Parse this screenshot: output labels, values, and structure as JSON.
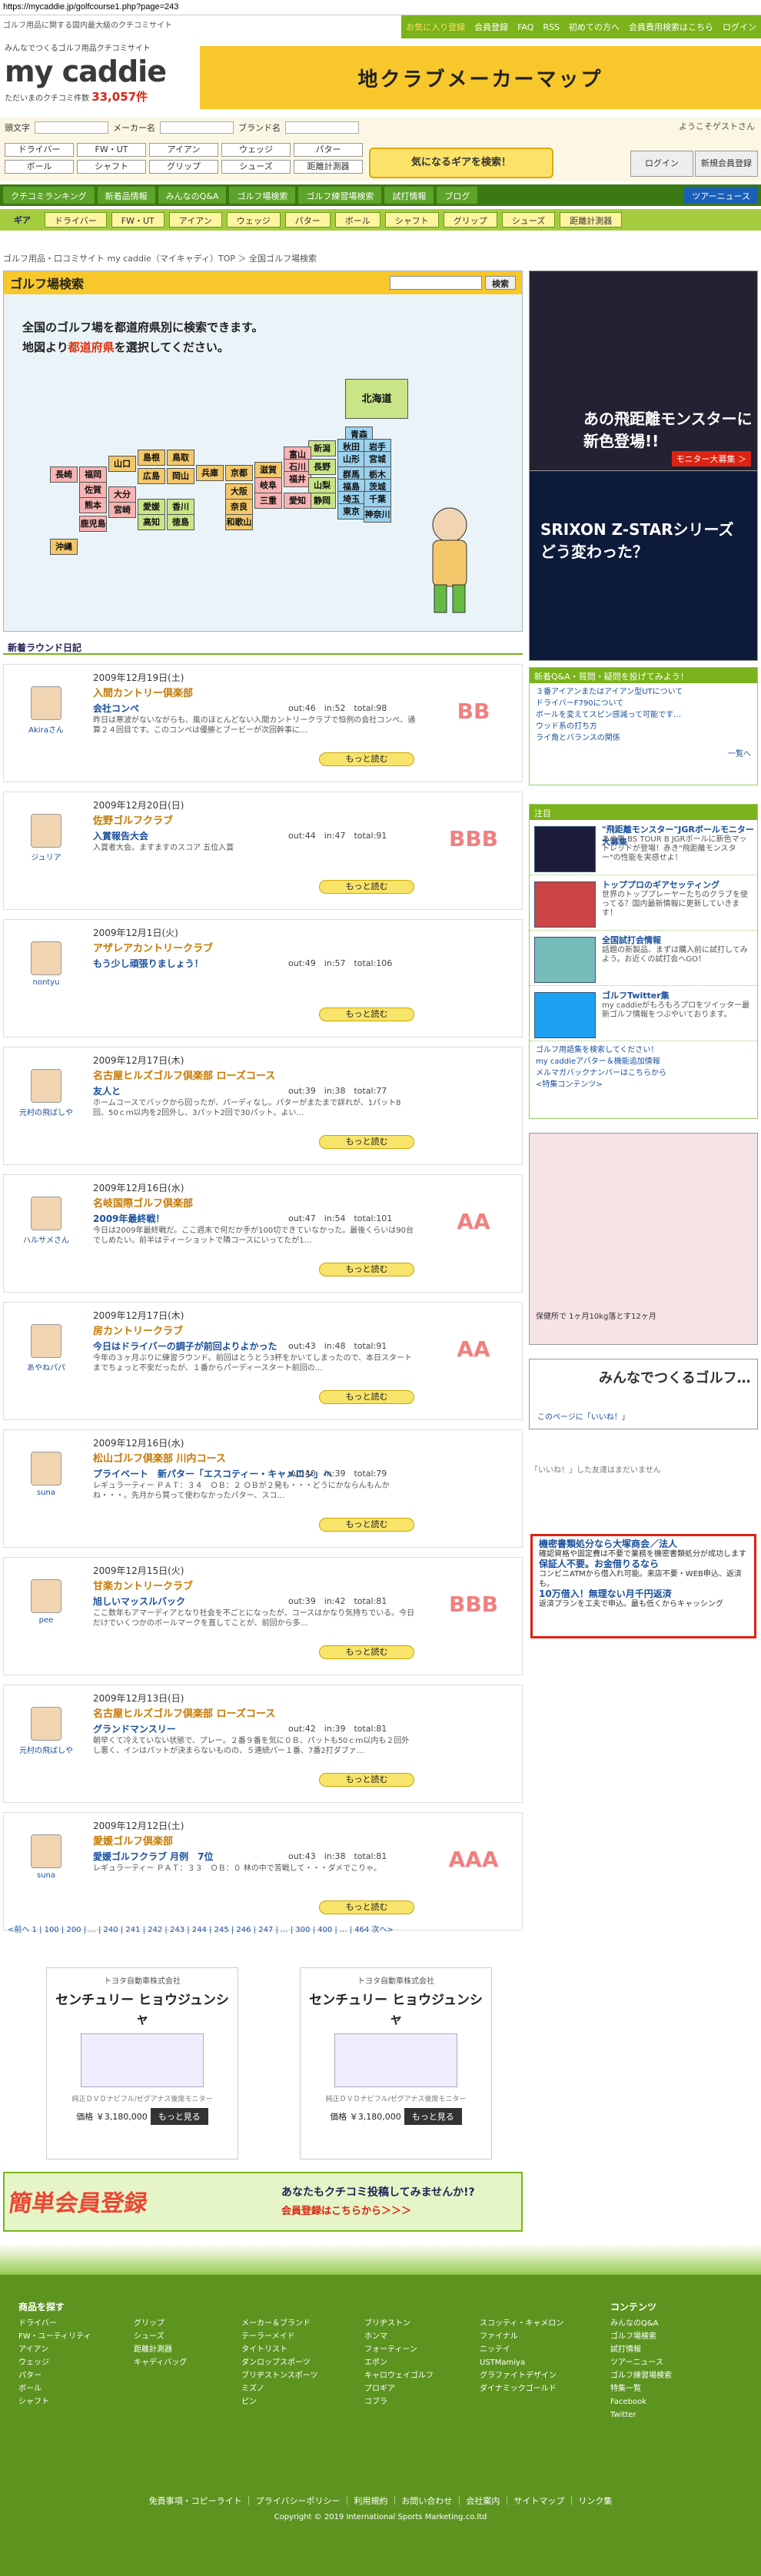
{
  "url": "https://mycaddie.jp/golfcourse1.php?page=243",
  "site": {
    "description": "ゴルフ用品に関する国内最大級のクチコミサイト",
    "tagline": "みんなでつくるゴルフ用品クチコミサイト",
    "logo": "my caddie",
    "count_label": "ただいまのクチコミ件数",
    "count": "33,057件"
  },
  "topnav": [
    "お気に入り登録",
    "会員登録",
    "FAQ",
    "RSS",
    "初めての方へ",
    "会員費用検索はこちら",
    "ログイン"
  ],
  "banner": "地クラブメーカーマップ",
  "search": {
    "filters": [
      "頭文字",
      "メーカー名",
      "ブランド名"
    ],
    "chips": [
      "ドライバー",
      "FW・UT",
      "アイアン",
      "ウェッジ",
      "パター",
      "ボール",
      "シャフト",
      "グリップ",
      "シューズ",
      "距離計測器"
    ],
    "find_button": "気になるギアを検索！",
    "welcome": "ようこそゲストさん",
    "login": "ログイン",
    "register": "新規会員登録"
  },
  "gnav": [
    "クチコミランキング",
    "新着品情報",
    "みんなのQ&A",
    "ゴルフ場検索",
    "ゴルフ練習場検索",
    "試打情報",
    "ブログ",
    "ツアーニュース"
  ],
  "cnav": [
    "ギア",
    "ドライバー",
    "FW・UT",
    "アイアン",
    "ウェッジ",
    "パター",
    "ボール",
    "シャフト",
    "グリップ",
    "シューズ",
    "距離計測器"
  ],
  "breadcrumb": "ゴルフ用品・口コミサイト my caddie（マイキャディ）TOP ＞ 全国ゴルフ場検索",
  "map": {
    "title": "ゴルフ場検索",
    "search_button": "検索",
    "intro1": "全国のゴルフ場を都道府県別に検索できます。",
    "intro2a": "地図より",
    "intro2b": "都道府県",
    "intro2c": "を選択してください。",
    "prefs": [
      "北海道",
      "青森",
      "秋田",
      "岩手",
      "山形",
      "宮城",
      "新潟",
      "富山",
      "石川",
      "福井",
      "長野",
      "群馬",
      "栃木",
      "茨城",
      "福島",
      "岐阜",
      "山梨",
      "埼玉",
      "東京",
      "千葉",
      "神奈川",
      "静岡",
      "愛知",
      "三重",
      "京都",
      "滋賀",
      "奈良",
      "大阪",
      "和歌山",
      "兵庫",
      "鳥取",
      "島根",
      "岡山",
      "広島",
      "山口",
      "香川",
      "徳島",
      "愛媛",
      "高知",
      "福岡",
      "佐賀",
      "長崎",
      "熊本",
      "大分",
      "宮崎",
      "鹿児島",
      "沖縄"
    ]
  },
  "rounds_title": "新着ラウンド日記",
  "rounds": [
    {
      "date": "2009年12月19日(土)",
      "course": "入間カントリー倶楽部",
      "title": "会社コンペ",
      "score": "out:46　in:52　total:98",
      "body": "昨日は寒波がないながらも、風のほとんどない入間カントリークラブで恒例の会社コンペ、通算２４回目です。このコンペは優勝とブービーが次回幹事に…",
      "user": "Akiraさん",
      "grade": "BB",
      "more": "もっと読む"
    },
    {
      "date": "2009年12月20日(日)",
      "course": "佐野ゴルフクラブ",
      "title": "入賞報告大会",
      "score": "out:44　in:47　total:91",
      "body": "入賞者大会。ますますのスコア 五位入賞",
      "user": "ジュリア",
      "grade": "BBB",
      "more": "もっと読む"
    },
    {
      "date": "2009年12月1日(火)",
      "course": "アザレアカントリークラブ",
      "title": "もう少し頑張りましょう！",
      "score": "out:49　in:57　total:106",
      "body": "",
      "user": "nontyu",
      "grade": "",
      "more": "もっと読む"
    },
    {
      "date": "2009年12月17日(木)",
      "course": "名古屋ヒルズゴルフ倶楽部 ローズコース",
      "title": "友人と",
      "score": "out:39　in:38　total:77",
      "body": "ホームコースでバックから回ったが、パーディなし。パターがまたまで詳れが、1パット8回、50ｃｍ以内を2回外し、3パット2回で30パット。よい…",
      "user": "元村の飛ばしや",
      "grade": "",
      "more": "もっと読む"
    },
    {
      "date": "2009年12月16日(水)",
      "course": "名岐国際ゴルフ倶楽部",
      "title": "2009年最終戦！",
      "score": "out:47　in:54　total:101",
      "body": "今日は2009年最終戦だ。ここ週末で何だか手が100切できていなかった。最後くらいは90台でしめたい。前半はティーショットで隣コースにいってたが1…",
      "user": "ハルサメさん",
      "grade": "AA",
      "more": "もっと読む"
    },
    {
      "date": "2009年12月17日(木)",
      "course": "房カントリークラブ",
      "title": "今日はドライバーの調子が前回よりよかった",
      "score": "out:43　in:48　total:91",
      "body": "今年の３ヶ月ぶりに練習ラウンド。前回はとうとう3杯をかいてしまったので、本日スタートまでちょっと不安だったが、１番からパーディースタート前回の…",
      "user": "あやねパパ",
      "grade": "AA",
      "more": "もっと読む"
    },
    {
      "date": "2009年12月16日(水)",
      "course": "松山ゴルフ倶楽部 川内コース",
      "title": "プライベート　新パター「エスコティー・キャメロン」へ",
      "score": "out:40　in:39　total:79",
      "body": "レギュラーティー ＰＡＴ：３４　ＯＢ：２ ＯＢが２発も・・・どうにかならんもんかね・・・。先月から買って使わなかったパター、スコ…",
      "user": "suna",
      "grade": "",
      "more": "もっと読む"
    },
    {
      "date": "2009年12月15日(火)",
      "course": "甘楽カントリークラブ",
      "title": "旭しいマッスルバック",
      "score": "out:39　in:42　total:81",
      "body": "ここ数年もアマーディアとなり社会を不ごとになったが、コースはかなり気持ちでいる。今日だけでいくつかのボールマークを直してことが、前回から多…",
      "user": "pee",
      "grade": "BBB",
      "more": "もっと読む"
    },
    {
      "date": "2009年12月13日(日)",
      "course": "名古屋ヒルズゴルフ倶楽部 ローズコース",
      "title": "グランドマンスリー",
      "score": "out:42　in:39　total:81",
      "body": "朝早くて冷えていない状態で、プレー。２番９番を気に０Ｂ、パットも50ｃｍ以内も２回外し悪く、インはパットが決まらないものの、５連続パー１番、7番2打ダブァ…",
      "user": "元村の飛ばしや",
      "grade": "",
      "more": "もっと読む"
    },
    {
      "date": "2009年12月12日(土)",
      "course": "愛媛ゴルフ倶楽部",
      "title": "愛媛ゴルフクラブ 月例　7位",
      "score": "out:43　in:38　total:81",
      "body": "レギュラーティー ＰＡＴ：３３　ＯＢ：０ 林の中で苦戦して・・・ダメでこりゃ。",
      "user": "suna",
      "grade": "AAA",
      "more": "もっと読む"
    }
  ],
  "pager": "<前へ  1 | 100 | 200 | ... | 240 | 241 | 242 | 243 | 244 | 245 | 246 | 247 | ... | 300 | 400 | ... | 464  次へ>",
  "ads": [
    {
      "sponsor": "トヨタ自動車株式会社",
      "name": "センチュリー ヒョウジュンシャ",
      "caption": "純正ＤＶＤナビフル/ゼグアナス後席モニター",
      "price": "価格 ￥3,180,000",
      "btn": "もっと見る"
    },
    {
      "sponsor": "トヨタ自動車株式会社",
      "name": "センチュリー ヒョウジュンシャ",
      "caption": "純正ＤＶＤナビフル/ゼグアナス後席モニター",
      "price": "価格 ￥3,180,000",
      "btn": "もっと見る"
    }
  ],
  "regbanner": {
    "left": "簡単会員登録",
    "r1": "あなたもクチコミ投稿してみませんか!?",
    "r2": "会員登録はこちらから＞＞＞"
  },
  "sidebar": {
    "ad1": "あの飛距離モンスターに新色登場!!",
    "ad1b": "モニター大募集 ＞",
    "ad2": "SRIXON Z-STARシリーズ どう変わった？",
    "qa_title": "新着Q&A・質問・疑問を投げてみよう！",
    "qa": [
      "３番アイアンまたはアイアン型UTについて",
      "ドライバーF790について",
      "ボールを変えてスピン感減って可能です…",
      "ウッド系の打ち方",
      "ライ角とバランスの関係"
    ],
    "qa_more": "一覧へ",
    "pick_title": "注目",
    "picks": [
      {
        "t": "\"飛距離モンスター\"JGRボールモニター大募集",
        "b": "あの男 BS TOUR B JGRボールに新色マットレッドが登場！赤き\"飛距離モンスター\"の性能を実感せよ！"
      },
      {
        "t": "トッププロのギアセッティング",
        "b": "世界のトッププレーヤーたちのクラブを使ってる？国内最新情報に更新していきます！"
      },
      {
        "t": "全国試打会情報",
        "b": "話題の新製品、まずは購入前に試打してみよう。お近くの試打会へGO！"
      },
      {
        "t": "ゴルフTwitter集",
        "b": "my caddieがもろもろプロをツイッター最新ゴルフ情報をつぶやいております。"
      }
    ],
    "links": [
      "ゴルフ用語集を検索してください！",
      "my caddieアバター＆機能追加情報",
      "メルマガバックナンバーはこちらから",
      "<特集コンテンツ>"
    ],
    "ad3": "保健所で 1ヶ月10kg落とす12ヶ月",
    "fb_title": "みんなでつくるゴルフ…",
    "fb_like": "このページに「いいね！」",
    "fb_note": "「いいね！」した友達はまだいません",
    "adred": [
      {
        "k": "機密書類処分なら大塚商会／法人",
        "b": "確認資格や固定費は不要で業務を機密書類処分が成功します"
      },
      {
        "k": "保証人不要。お金借りるなら",
        "b": "コンビニATMから借入れ可能。来店不要・WEB申込、返済も。"
      },
      {
        "k": "10万借入！無理ない月千円返済",
        "b": "返済プランを工夫で申込。最も低くからキャッシング"
      }
    ]
  },
  "footer": {
    "col1_title": "商品を探す",
    "col1": [
      "ドライバー",
      "FW・ユーティリティ",
      "アイアン",
      "ウェッジ",
      "パター",
      "ボール",
      "シャフト"
    ],
    "col2": [
      "グリップ",
      "シューズ",
      "距離計測器",
      "キャディバッグ"
    ],
    "col3": [
      "メーカー＆ブランド",
      "テーラーメイド",
      "タイトリスト",
      "ダンロップスポーツ",
      "ブリヂストンスポーツ",
      "ミズノ",
      "ピン"
    ],
    "col4": [
      "ブリヂストン",
      "ホンマ",
      "フォーティーン",
      "エポン",
      "キャロウェイゴルフ",
      "プロギア",
      "コブラ"
    ],
    "col5": [
      "スコッティ・キャメロン",
      "ファイナル",
      "ニッテイ",
      "USTMamiya",
      "グラファイトデザイン",
      "ダイナミックゴールド"
    ],
    "col6_title": "コンテンツ",
    "col6": [
      "みんなのQ&A",
      "ゴルフ場検索",
      "試打情報",
      "ツアーニュース",
      "ゴルフ練習場検索",
      "特集一覧",
      "Facebook",
      "Twitter"
    ],
    "links": "免責事項・コピーライト ｜ プライバシーポリシー ｜ 利用規約 ｜ お問い合わせ ｜ 会社案内 ｜ サイトマップ ｜ リンク集",
    "copy": "Copyright © 2019 International Sports Marketing.co.ltd"
  }
}
